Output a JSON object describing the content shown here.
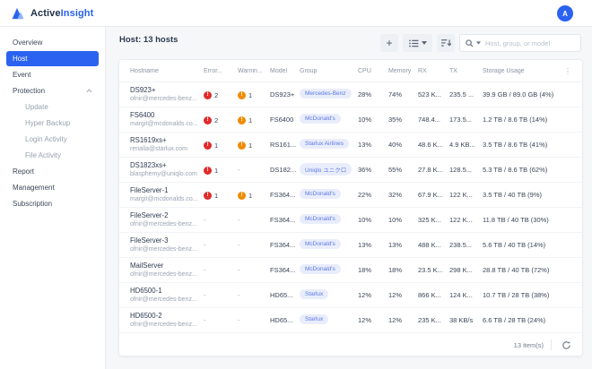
{
  "brand": {
    "name_primary": "Active",
    "name_secondary": "Insight",
    "avatar_letter": "A"
  },
  "sidebar": {
    "items": [
      {
        "label": "Overview"
      },
      {
        "label": "Host"
      },
      {
        "label": "Event"
      },
      {
        "label": "Protection"
      },
      {
        "label": "Update"
      },
      {
        "label": "Hyper Backup"
      },
      {
        "label": "Login Activity"
      },
      {
        "label": "File Activity"
      },
      {
        "label": "Report"
      },
      {
        "label": "Management"
      },
      {
        "label": "Subscription"
      }
    ]
  },
  "page": {
    "title": "Host: 13 hosts"
  },
  "toolbar": {
    "add_label": "+",
    "search_placeholder": "Host, group, or model"
  },
  "table": {
    "columns": {
      "hostname": "Hostname",
      "error": "Error...",
      "warning": "Warnin...",
      "model": "Model",
      "group": "Group",
      "cpu": "CPU",
      "memory": "Memory",
      "rx": "RX",
      "tx": "TX",
      "storage": "Storage Usage",
      "more": "⋮"
    },
    "rows": [
      {
        "hostname": "DS923+",
        "owner": "ofnir@mercedes-benz...",
        "error": "2",
        "warning": "1",
        "model": "DS923+",
        "group": "Mercedes-Benz",
        "cpu": "28%",
        "memory": "74%",
        "rx": "523 K...",
        "tx": "235.5 ...",
        "storage": "39.9 GB / 89.0 GB (4%)"
      },
      {
        "hostname": "FS6400",
        "owner": "margit@mcdonalds.co...",
        "error": "2",
        "warning": "1",
        "model": "FS6400",
        "group": "McDonald's",
        "cpu": "10%",
        "memory": "35%",
        "rx": "748.4...",
        "tx": "173.5...",
        "storage": "1.2 TB / 8.6 TB (14%)"
      },
      {
        "hostname": "RS1619xs+",
        "owner": "renalla@starlux.com",
        "error": "1",
        "warning": "1",
        "model": "RS161...",
        "group": "Starlux Airlines",
        "cpu": "13%",
        "memory": "40%",
        "rx": "48.6 K...",
        "tx": "4.9 KB...",
        "storage": "3.5 TB / 8.6 TB (41%)"
      },
      {
        "hostname": "DS1823xs+",
        "owner": "blasphemy@uniqlo.com",
        "error": "1",
        "warning": "-",
        "model": "DS182...",
        "group": "Uniqlo ユニクロ",
        "cpu": "36%",
        "memory": "55%",
        "rx": "27.8 K...",
        "tx": "128.5...",
        "storage": "5.3 TB / 8.6 TB (62%)"
      },
      {
        "hostname": "FileServer-1",
        "owner": "margit@mcdonalds.co...",
        "error": "1",
        "warning": "1",
        "model": "FS364...",
        "group": "McDonald's",
        "cpu": "22%",
        "memory": "32%",
        "rx": "67.9 K...",
        "tx": "122 K...",
        "storage": "3.5 TB / 40 TB (9%)"
      },
      {
        "hostname": "FileServer-2",
        "owner": "ofnir@mercedes-benz...",
        "error": "-",
        "warning": "-",
        "model": "FS364...",
        "group": "McDonald's",
        "cpu": "10%",
        "memory": "10%",
        "rx": "325 K...",
        "tx": "122 K...",
        "storage": "11.8 TB / 40 TB (30%)"
      },
      {
        "hostname": "FileServer-3",
        "owner": "ofnir@mercedes-benz...",
        "error": "-",
        "warning": "-",
        "model": "FS364...",
        "group": "McDonald's",
        "cpu": "13%",
        "memory": "13%",
        "rx": "488 K...",
        "tx": "238.5...",
        "storage": "5.6 TB / 40 TB (14%)"
      },
      {
        "hostname": "MailServer",
        "owner": "ofnir@mercedes-benz...",
        "error": "-",
        "warning": "-",
        "model": "FS364...",
        "group": "McDonald's",
        "cpu": "18%",
        "memory": "18%",
        "rx": "23.5 K...",
        "tx": "298 K...",
        "storage": "28.8 TB / 40 TB (72%)"
      },
      {
        "hostname": "HD6500-1",
        "owner": "ofnir@mercedes-benz...",
        "error": "-",
        "warning": "-",
        "model": "HD65...",
        "group": "Starlux",
        "cpu": "12%",
        "memory": "12%",
        "rx": "866 K...",
        "tx": "124 K...",
        "storage": "10.7 TB / 28 TB (38%)"
      },
      {
        "hostname": "HD6500-2",
        "owner": "ofnir@mercedes-benz...",
        "error": "-",
        "warning": "-",
        "model": "HD65...",
        "group": "Starlux",
        "cpu": "12%",
        "memory": "12%",
        "rx": "235 K...",
        "tx": "38 KB/s",
        "storage": "6.6 TB / 28 TB (24%)"
      }
    ],
    "footer": {
      "item_count": "13 item(s)"
    }
  },
  "colors": {
    "accent": "#2b63f0",
    "error": "#e02b2b",
    "warning": "#f08b00",
    "tag_bg": "#e9edfb",
    "tag_text": "#5b79e4"
  }
}
